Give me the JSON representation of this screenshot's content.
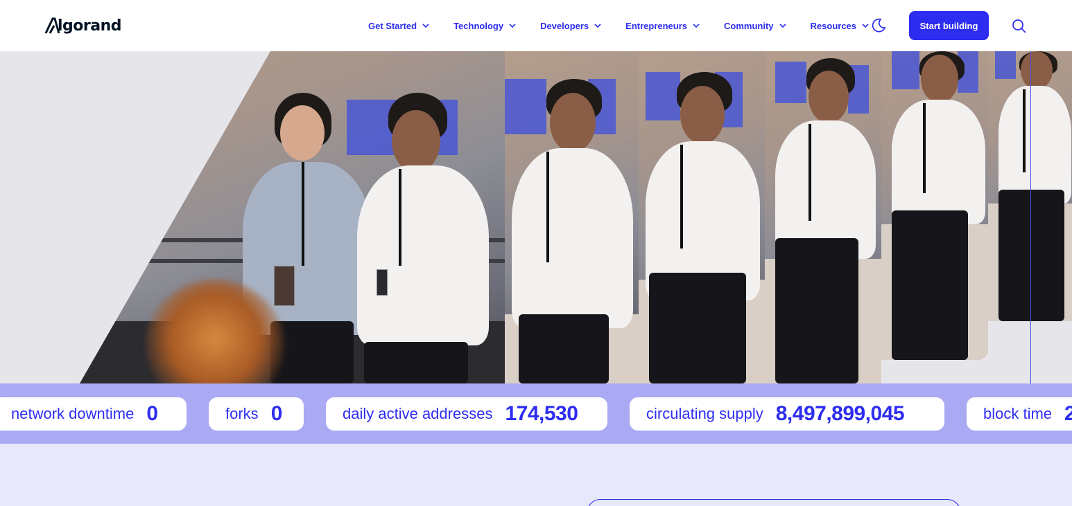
{
  "header": {
    "logo_text": "lgorand",
    "nav": [
      {
        "label": "Get Started"
      },
      {
        "label": "Technology"
      },
      {
        "label": "Developers"
      },
      {
        "label": "Entrepreneurs"
      },
      {
        "label": "Community"
      },
      {
        "label": "Resources"
      }
    ],
    "cta_label": "Start building",
    "icons": {
      "theme": "moon-icon",
      "search": "search-icon",
      "nav_chevron": "chevron-down-icon"
    }
  },
  "stats": [
    {
      "label": "network downtime",
      "value": "0"
    },
    {
      "label": "forks",
      "value": "0"
    },
    {
      "label": "daily active addresses",
      "value": "174,530"
    },
    {
      "label": "circulating supply",
      "value": "8,497,899,045"
    },
    {
      "label": "block time",
      "value": "2"
    }
  ],
  "colors": {
    "accent": "#2d2df1",
    "ticker_bg": "#a9a9f4",
    "page_bg": "#e8e8fb",
    "logo": "#001324"
  }
}
